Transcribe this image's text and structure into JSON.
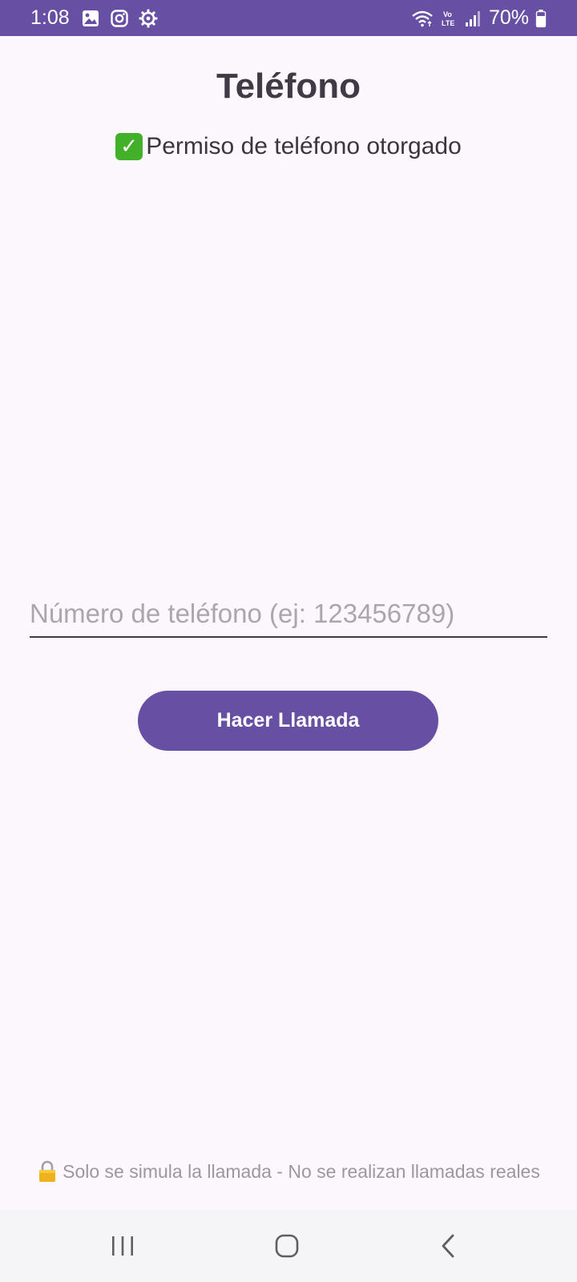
{
  "status_bar": {
    "time": "1:08",
    "battery": "70%",
    "icons": [
      "gallery-icon",
      "instagram-icon",
      "settings-gear-icon",
      "wifi-icon",
      "volte-icon",
      "signal-icon",
      "battery-icon"
    ],
    "background_color": "#6750a4"
  },
  "screen": {
    "title": "Teléfono",
    "permission_status": "Permiso de teléfono otorgado",
    "permission_icon": "check-mark-icon"
  },
  "phone_input": {
    "placeholder": "Número de teléfono (ej: 123456789)",
    "value": ""
  },
  "call_button": {
    "label": "Hacer Llamada",
    "color": "#6750a4"
  },
  "footer": {
    "icon": "lock-icon",
    "note": "Solo se simula la llamada - No se realizan llamadas reales"
  },
  "nav_bar": {
    "buttons": [
      "recent-apps-icon",
      "home-icon",
      "back-icon"
    ]
  }
}
